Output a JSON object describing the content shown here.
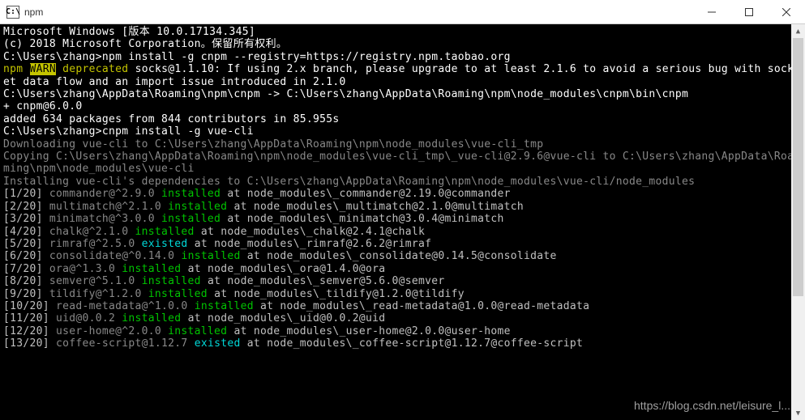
{
  "window": {
    "icon_label": "C:\\",
    "title": "npm"
  },
  "lines": {
    "l01": "Microsoft Windows [版本 10.0.17134.345]",
    "l02": "(c) 2018 Microsoft Corporation。保留所有权利。",
    "l03": "",
    "cmd1_prompt": "C:\\Users\\zhang>",
    "cmd1_cmd": "npm install -g cnpm --registry=https://registry.npm.taobao.org",
    "warn_prefix": "npm ",
    "warn_tag": "WARN",
    "warn_deprecated": " deprecated",
    "warn_rest": " socks@1.1.10: If using 2.x branch, please upgrade to at least 2.1.6 to avoid a serious bug with sock",
    "warn_l2": "et data flow and an import issue introduced in 2.1.0",
    "link_line": "C:\\Users\\zhang\\AppData\\Roaming\\npm\\cnpm -> C:\\Users\\zhang\\AppData\\Roaming\\npm\\node_modules\\cnpm\\bin\\cnpm",
    "added_plus": "+ cnpm@6.0.0",
    "added_line": "added 634 packages from 844 contributors in 85.955s",
    "blank": "",
    "cmd2_prompt": "C:\\Users\\zhang>",
    "cmd2_cmd": "cnpm install -g vue-cli",
    "dl_line": "Downloading vue-cli to C:\\Users\\zhang\\AppData\\Roaming\\npm\\node_modules\\vue-cli_tmp",
    "cp_line1": "Copying C:\\Users\\zhang\\AppData\\Roaming\\npm\\node_modules\\vue-cli_tmp\\_vue-cli@2.9.6@vue-cli to C:\\Users\\zhang\\AppData\\Roa",
    "cp_line2": "ming\\npm\\node_modules\\vue-cli",
    "inst_deps": "Installing vue-cli's dependencies to C:\\Users\\zhang\\AppData\\Roaming\\npm\\node_modules\\vue-cli/node_modules"
  },
  "pkgs": [
    {
      "n": "[1/20] ",
      "name": "commander@^2.9.0 ",
      "st": "installed",
      "rest": " at node_modules\\_commander@2.19.0@commander"
    },
    {
      "n": "[2/20] ",
      "name": "multimatch@^2.1.0 ",
      "st": "installed",
      "rest": " at node_modules\\_multimatch@2.1.0@multimatch"
    },
    {
      "n": "[3/20] ",
      "name": "minimatch@^3.0.0 ",
      "st": "installed",
      "rest": " at node_modules\\_minimatch@3.0.4@minimatch"
    },
    {
      "n": "[4/20] ",
      "name": "chalk@^2.1.0 ",
      "st": "installed",
      "rest": " at node_modules\\_chalk@2.4.1@chalk"
    },
    {
      "n": "[5/20] ",
      "name": "rimraf@^2.5.0 ",
      "st": "existed",
      "rest": " at node_modules\\_rimraf@2.6.2@rimraf"
    },
    {
      "n": "[6/20] ",
      "name": "consolidate@^0.14.0 ",
      "st": "installed",
      "rest": " at node_modules\\_consolidate@0.14.5@consolidate"
    },
    {
      "n": "[7/20] ",
      "name": "ora@^1.3.0 ",
      "st": "installed",
      "rest": " at node_modules\\_ora@1.4.0@ora"
    },
    {
      "n": "[8/20] ",
      "name": "semver@^5.1.0 ",
      "st": "installed",
      "rest": " at node_modules\\_semver@5.6.0@semver"
    },
    {
      "n": "[9/20] ",
      "name": "tildify@^1.2.0 ",
      "st": "installed",
      "rest": " at node_modules\\_tildify@1.2.0@tildify"
    },
    {
      "n": "[10/20] ",
      "name": "read-metadata@^1.0.0 ",
      "st": "installed",
      "rest": " at node_modules\\_read-metadata@1.0.0@read-metadata"
    },
    {
      "n": "[11/20] ",
      "name": "uid@0.0.2 ",
      "st": "installed",
      "rest": " at node_modules\\_uid@0.0.2@uid"
    },
    {
      "n": "[12/20] ",
      "name": "user-home@^2.0.0 ",
      "st": "installed",
      "rest": " at node_modules\\_user-home@2.0.0@user-home"
    },
    {
      "n": "[13/20] ",
      "name": "coffee-script@1.12.7 ",
      "st": "existed",
      "rest": " at node_modules\\_coffee-script@1.12.7@coffee-script"
    }
  ],
  "watermark": "https://blog.csdn.net/leisure_l..."
}
